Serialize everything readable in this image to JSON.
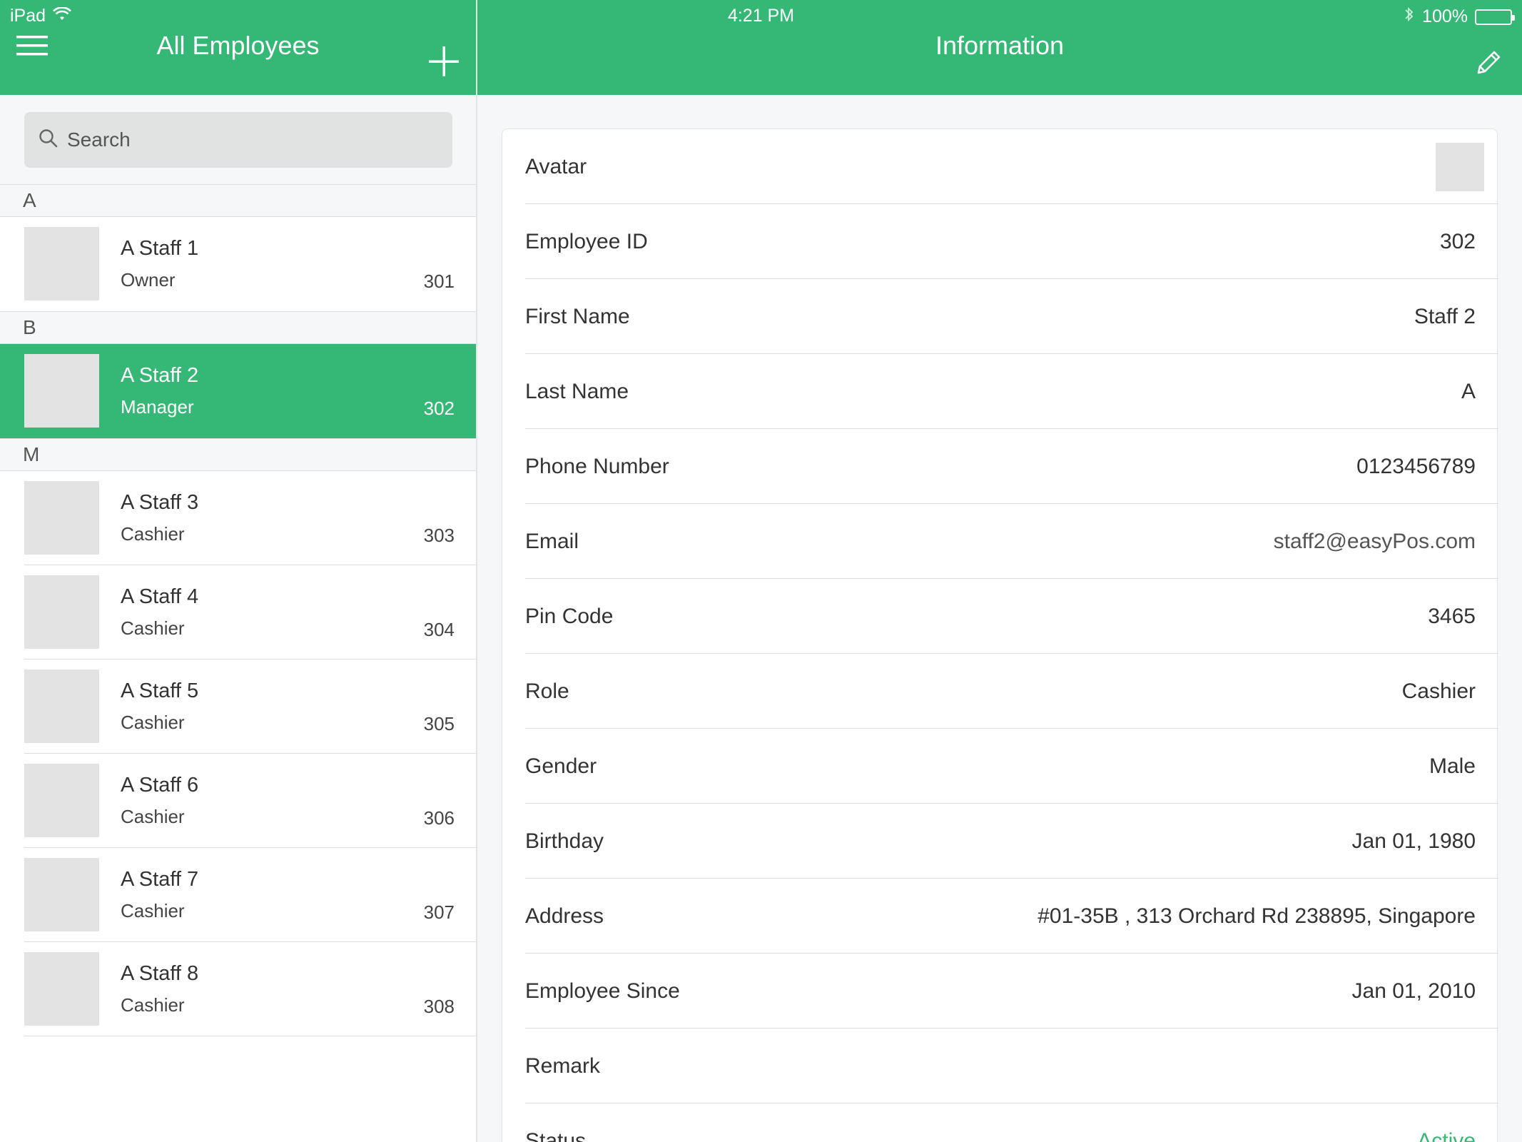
{
  "status_bar": {
    "device": "iPad",
    "time": "4:21 PM",
    "battery": "100%"
  },
  "nav": {
    "left_title": "All Employees",
    "right_title": "Information"
  },
  "search": {
    "placeholder": "Search"
  },
  "sections": [
    {
      "letter": "A",
      "employees": [
        {
          "name": "A Staff 1",
          "role": "Owner",
          "id": "301",
          "selected": false
        }
      ]
    },
    {
      "letter": "B",
      "employees": [
        {
          "name": "A Staff 2",
          "role": "Manager",
          "id": "302",
          "selected": true
        }
      ]
    },
    {
      "letter": "M",
      "employees": [
        {
          "name": "A Staff 3",
          "role": "Cashier",
          "id": "303",
          "selected": false
        },
        {
          "name": "A Staff 4",
          "role": "Cashier",
          "id": "304",
          "selected": false
        },
        {
          "name": "A Staff 5",
          "role": "Cashier",
          "id": "305",
          "selected": false
        },
        {
          "name": "A Staff 6",
          "role": "Cashier",
          "id": "306",
          "selected": false
        },
        {
          "name": "A Staff 7",
          "role": "Cashier",
          "id": "307",
          "selected": false
        },
        {
          "name": "A Staff 8",
          "role": "Cashier",
          "id": "308",
          "selected": false
        }
      ]
    }
  ],
  "detail": {
    "fields": [
      {
        "key": "avatar",
        "label": "Avatar",
        "value": ""
      },
      {
        "key": "employee-id",
        "label": "Employee ID",
        "value": "302"
      },
      {
        "key": "first-name",
        "label": "First Name",
        "value": "Staff 2"
      },
      {
        "key": "last-name",
        "label": "Last Name",
        "value": "A"
      },
      {
        "key": "phone-number",
        "label": "Phone Number",
        "value": "0123456789"
      },
      {
        "key": "email",
        "label": "Email",
        "value": "staff2@easyPos.com"
      },
      {
        "key": "pin-code",
        "label": "Pin Code",
        "value": "3465"
      },
      {
        "key": "role",
        "label": "Role",
        "value": "Cashier"
      },
      {
        "key": "gender",
        "label": "Gender",
        "value": "Male"
      },
      {
        "key": "birthday",
        "label": "Birthday",
        "value": "Jan 01, 1980"
      },
      {
        "key": "address",
        "label": "Address",
        "value": "#01-35B , 313 Orchard Rd 238895, Singapore"
      },
      {
        "key": "employee-since",
        "label": "Employee Since",
        "value": "Jan 01, 2010"
      },
      {
        "key": "remark",
        "label": "Remark",
        "value": ""
      },
      {
        "key": "status",
        "label": "Status",
        "value": "Active"
      }
    ]
  },
  "colors": {
    "accent": "#35b876",
    "background": "#f6f7f8",
    "avatar_placeholder": "#e3e3e3"
  },
  "icons": [
    "wifi-icon",
    "bluetooth-icon",
    "battery-icon",
    "menu-icon",
    "plus-icon",
    "pencil-icon",
    "search-icon"
  ]
}
